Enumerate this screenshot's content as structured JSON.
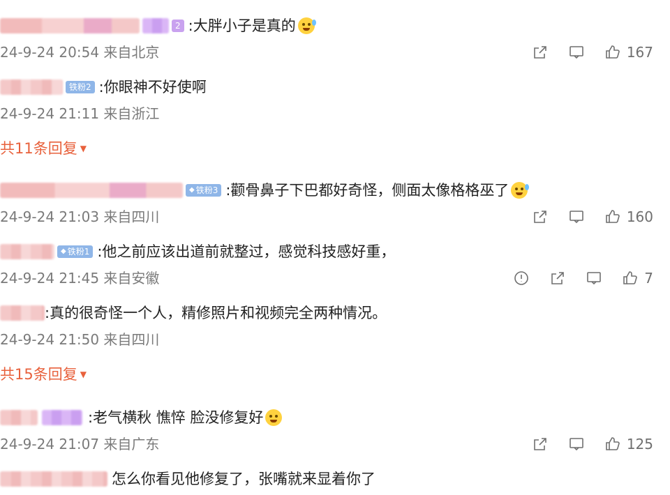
{
  "comments": [
    {
      "text": ":大胖小子是真的",
      "badge": "2",
      "emoji": "crying-face",
      "meta": "24-9-24 20:54 来自北京",
      "likes": "167"
    },
    {
      "text": ":你眼神不好使啊",
      "badge": "铁粉2",
      "meta": "24-9-24 21:11 来自浙江"
    },
    {
      "text": ":颧骨鼻子下巴都好奇怪，侧面太像格格巫了",
      "badge": "铁粉3",
      "emoji": "sweat-face",
      "meta": "24-9-24 21:03 来自四川",
      "likes": "160"
    },
    {
      "text": ":他之前应该出道前就整过，感觉科技感好重，",
      "badge": "铁粉1",
      "meta": "24-9-24 21:45 来自安徽",
      "likes": "7"
    },
    {
      "text": ":真的很奇怪一个人，精修照片和视频完全两种情况。",
      "meta": "24-9-24 21:50 来自四川"
    },
    {
      "text": ":老气横秋 憔悴 脸没修复好",
      "emoji": "doge-face",
      "meta": "24-9-24 21:07 来自广东",
      "likes": "125"
    },
    {
      "text": "怎么你看见他修复了，张嘴就来显着你了"
    }
  ],
  "replies_more": [
    {
      "label": "共11条回复"
    },
    {
      "label": "共15条回复"
    }
  ]
}
